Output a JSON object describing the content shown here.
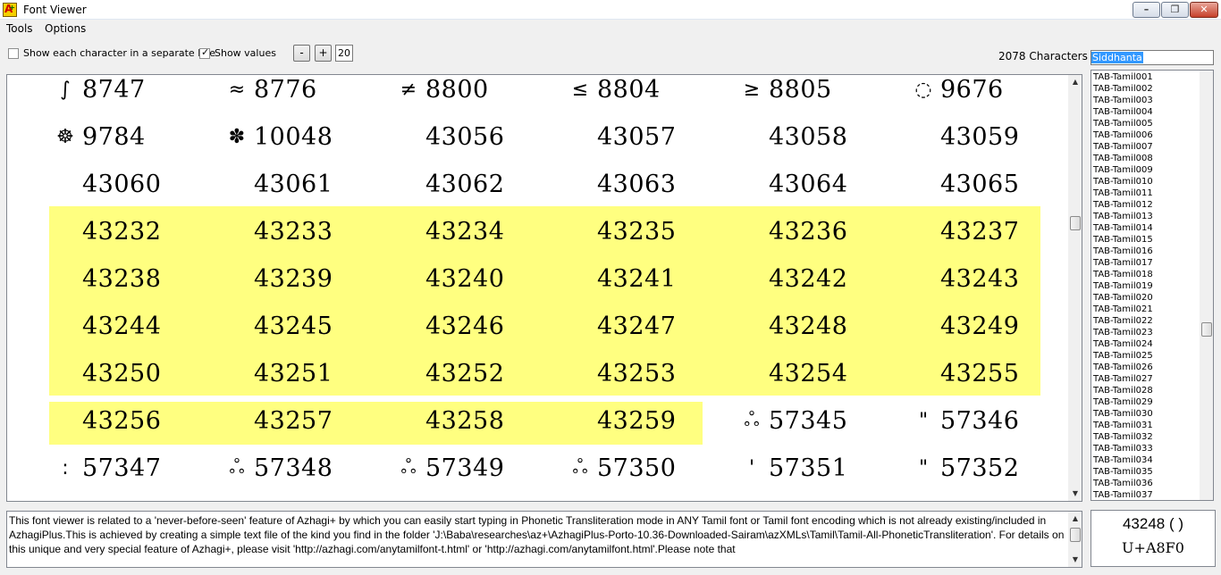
{
  "window": {
    "title": "Font Viewer",
    "icon_letter": "A",
    "icon_mark": "+",
    "controls": {
      "minimize": "minimize-icon",
      "maximize": "maximize-icon",
      "close": "close-icon"
    }
  },
  "menu": [
    "Tools",
    "Options"
  ],
  "toolbar": {
    "separate_line_label": "Show each character in a separate line",
    "separate_line_checked": false,
    "show_values_label": "Show values",
    "show_values_checked": true,
    "minus_label": "-",
    "plus_label": "+",
    "font_size": "20",
    "char_count": "2078 Characters",
    "font_name": "Siddhanta"
  },
  "characters": [
    [
      {
        "g": "∫",
        "v": "8747"
      },
      {
        "g": "≈",
        "v": "8776"
      },
      {
        "g": "≠",
        "v": "8800"
      },
      {
        "g": "≤",
        "v": "8804"
      },
      {
        "g": "≥",
        "v": "8805"
      },
      {
        "g": "◌",
        "v": "9676"
      }
    ],
    [
      {
        "g": "☸",
        "v": "9784"
      },
      {
        "g": "✽",
        "v": "10048"
      },
      {
        "g": "",
        "v": "43056"
      },
      {
        "g": "",
        "v": "43057"
      },
      {
        "g": "",
        "v": "43058"
      },
      {
        "g": "",
        "v": "43059"
      }
    ],
    [
      {
        "g": "",
        "v": "43060"
      },
      {
        "g": "",
        "v": "43061"
      },
      {
        "g": "",
        "v": "43062"
      },
      {
        "g": "",
        "v": "43063"
      },
      {
        "g": "",
        "v": "43064"
      },
      {
        "g": "",
        "v": "43065"
      }
    ],
    [
      {
        "g": "",
        "v": "43232"
      },
      {
        "g": "",
        "v": "43233"
      },
      {
        "g": "",
        "v": "43234"
      },
      {
        "g": "",
        "v": "43235"
      },
      {
        "g": "",
        "v": "43236"
      },
      {
        "g": "",
        "v": "43237"
      }
    ],
    [
      {
        "g": "",
        "v": "43238"
      },
      {
        "g": "",
        "v": "43239"
      },
      {
        "g": "",
        "v": "43240"
      },
      {
        "g": "",
        "v": "43241"
      },
      {
        "g": "",
        "v": "43242"
      },
      {
        "g": "",
        "v": "43243"
      }
    ],
    [
      {
        "g": "",
        "v": "43244"
      },
      {
        "g": "",
        "v": "43245"
      },
      {
        "g": "",
        "v": "43246"
      },
      {
        "g": "",
        "v": "43247"
      },
      {
        "g": "",
        "v": "43248"
      },
      {
        "g": "",
        "v": "43249"
      }
    ],
    [
      {
        "g": "",
        "v": "43250"
      },
      {
        "g": "",
        "v": "43251"
      },
      {
        "g": "",
        "v": "43252"
      },
      {
        "g": "",
        "v": "43253"
      },
      {
        "g": "",
        "v": "43254"
      },
      {
        "g": "",
        "v": "43255"
      }
    ],
    [
      {
        "g": "",
        "v": "43256"
      },
      {
        "g": "",
        "v": "43257"
      },
      {
        "g": "",
        "v": "43258"
      },
      {
        "g": "",
        "v": "43259"
      },
      {
        "g": "ஃ",
        "v": "57345"
      },
      {
        "g": "\"",
        "v": "57346"
      }
    ],
    [
      {
        "g": ":",
        "v": "57347"
      },
      {
        "g": "ஃ",
        "v": "57348"
      },
      {
        "g": "ஃ",
        "v": "57349"
      },
      {
        "g": "ஃ",
        "v": "57350"
      },
      {
        "g": "'",
        "v": "57351"
      },
      {
        "g": "\"",
        "v": "57352"
      }
    ]
  ],
  "highlight_color": "#ffff80",
  "font_list": [
    "TAB-Tamil001",
    "TAB-Tamil002",
    "TAB-Tamil003",
    "TAB-Tamil004",
    "TAB-Tamil005",
    "TAB-Tamil006",
    "TAB-Tamil007",
    "TAB-Tamil008",
    "TAB-Tamil009",
    "TAB-Tamil010",
    "TAB-Tamil011",
    "TAB-Tamil012",
    "TAB-Tamil013",
    "TAB-Tamil014",
    "TAB-Tamil015",
    "TAB-Tamil016",
    "TAB-Tamil017",
    "TAB-Tamil018",
    "TAB-Tamil019",
    "TAB-Tamil020",
    "TAB-Tamil021",
    "TAB-Tamil022",
    "TAB-Tamil023",
    "TAB-Tamil024",
    "TAB-Tamil025",
    "TAB-Tamil026",
    "TAB-Tamil027",
    "TAB-Tamil028",
    "TAB-Tamil029",
    "TAB-Tamil030",
    "TAB-Tamil031",
    "TAB-Tamil032",
    "TAB-Tamil033",
    "TAB-Tamil034",
    "TAB-Tamil035",
    "TAB-Tamil036",
    "TAB-Tamil037"
  ],
  "description": "This font viewer is related to a 'never-before-seen' feature of Azhagi+ by which you can easily start typing in Phonetic Transliteration mode in ANY Tamil font or Tamil font encoding which is not already existing/included in AzhagiPlus.This is achieved by creating a simple text file of the kind you find in the folder 'J:\\Baba\\researches\\az+\\AzhagiPlus-Porto-10.36-Downloaded-Sairam\\azXMLs\\Tamil\\Tamil-All-PhoneticTransliteration'. For details on this unique and very special feature of Azhagi+, please visit 'http://azhagi.com/anytamilfont-t.html' or 'http://azhagi.com/anytamilfont.html'.Please note that",
  "preview": {
    "value": "43248 (   )",
    "code": "U+A8F0"
  }
}
